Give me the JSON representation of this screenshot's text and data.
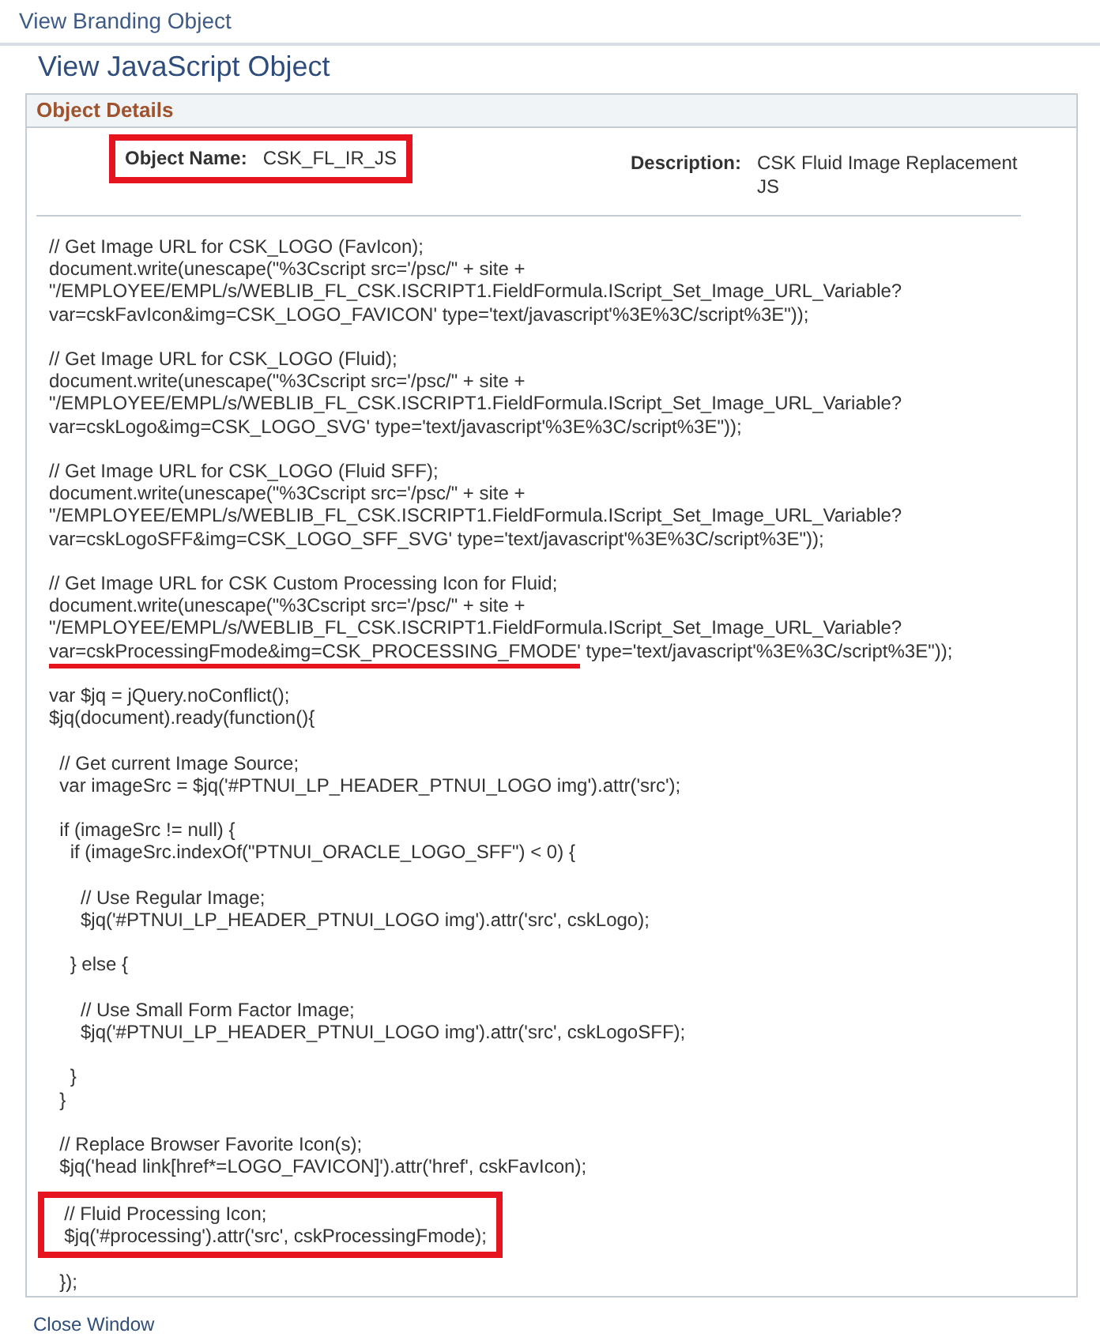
{
  "header": {
    "title": "View Branding Object"
  },
  "page": {
    "title": "View JavaScript Object"
  },
  "panel": {
    "title": "Object Details",
    "fields": [
      {
        "label": "Object Name:",
        "value": "CSK_FL_IR_JS",
        "boxed": true
      },
      {
        "label": "Description:",
        "value": "CSK Fluid Image Replacement JS",
        "boxed": false
      }
    ],
    "code_blocks": [
      {
        "boxed": false,
        "lines": [
          "// Get Image URL for CSK_LOGO (FavIcon);",
          "document.write(unescape(\"%3Cscript src='/psc/\" + site +",
          "\"/EMPLOYEE/EMPL/s/WEBLIB_FL_CSK.ISCRIPT1.FieldFormula.IScript_Set_Image_URL_Variable?",
          "var=cskFavIcon&img=CSK_LOGO_FAVICON' type='text/javascript'%3E%3C/script%3E\"));"
        ]
      },
      {
        "boxed": false,
        "lines": [
          "// Get Image URL for CSK_LOGO (Fluid);",
          "document.write(unescape(\"%3Cscript src='/psc/\" + site +",
          "\"/EMPLOYEE/EMPL/s/WEBLIB_FL_CSK.ISCRIPT1.FieldFormula.IScript_Set_Image_URL_Variable?",
          "var=cskLogo&img=CSK_LOGO_SVG' type='text/javascript'%3E%3C/script%3E\"));"
        ]
      },
      {
        "boxed": false,
        "lines": [
          "// Get Image URL for CSK_LOGO (Fluid SFF);",
          "document.write(unescape(\"%3Cscript src='/psc/\" + site +",
          "\"/EMPLOYEE/EMPL/s/WEBLIB_FL_CSK.ISCRIPT1.FieldFormula.IScript_Set_Image_URL_Variable?",
          "var=cskLogoSFF&img=CSK_LOGO_SFF_SVG' type='text/javascript'%3E%3C/script%3E\"));"
        ]
      },
      {
        "boxed": false,
        "lines": [
          "// Get Image URL for CSK Custom Processing Icon for Fluid;",
          "document.write(unescape(\"%3Cscript src='/psc/\" + site +",
          "\"/EMPLOYEE/EMPL/s/WEBLIB_FL_CSK.ISCRIPT1.FieldFormula.IScript_Set_Image_URL_Variable?",
          {
            "parts": [
              {
                "text": "var=cskProcessingFmode&img=CSK_PROCESSING_FMODE'",
                "underlined": true
              },
              {
                "text": " type='text/javascript'%3E%3C/script%3E\"));",
                "underlined": false
              }
            ]
          }
        ]
      },
      {
        "boxed": false,
        "lines": [
          "var $jq = jQuery.noConflict();",
          "$jq(document).ready(function(){"
        ]
      },
      {
        "boxed": false,
        "lines": [
          "  // Get current Image Source;",
          "  var imageSrc = $jq('#PTNUI_LP_HEADER_PTNUI_LOGO img').attr('src');"
        ]
      },
      {
        "boxed": false,
        "lines": [
          "  if (imageSrc != null) {",
          "    if (imageSrc.indexOf(\"PTNUI_ORACLE_LOGO_SFF\") < 0) {"
        ]
      },
      {
        "boxed": false,
        "lines": [
          "      // Use Regular Image;",
          "      $jq('#PTNUI_LP_HEADER_PTNUI_LOGO img').attr('src', cskLogo);"
        ]
      },
      {
        "boxed": false,
        "lines": [
          "    } else {"
        ]
      },
      {
        "boxed": false,
        "lines": [
          "      // Use Small Form Factor Image;",
          "      $jq('#PTNUI_LP_HEADER_PTNUI_LOGO img').attr('src', cskLogoSFF);"
        ]
      },
      {
        "boxed": false,
        "lines": [
          "    }",
          "  }"
        ]
      },
      {
        "boxed": false,
        "lines": [
          "  // Replace Browser Favorite Icon(s);",
          "  $jq('head link[href*=LOGO_FAVICON]').attr('href', cskFavIcon);"
        ]
      },
      {
        "boxed": true,
        "lines": [
          "  // Fluid Processing Icon;",
          "  $jq('#processing').attr('src', cskProcessingFmode);"
        ]
      },
      {
        "boxed": false,
        "lines": [
          "  });"
        ]
      }
    ]
  },
  "footer": {
    "link": "Close Window"
  }
}
